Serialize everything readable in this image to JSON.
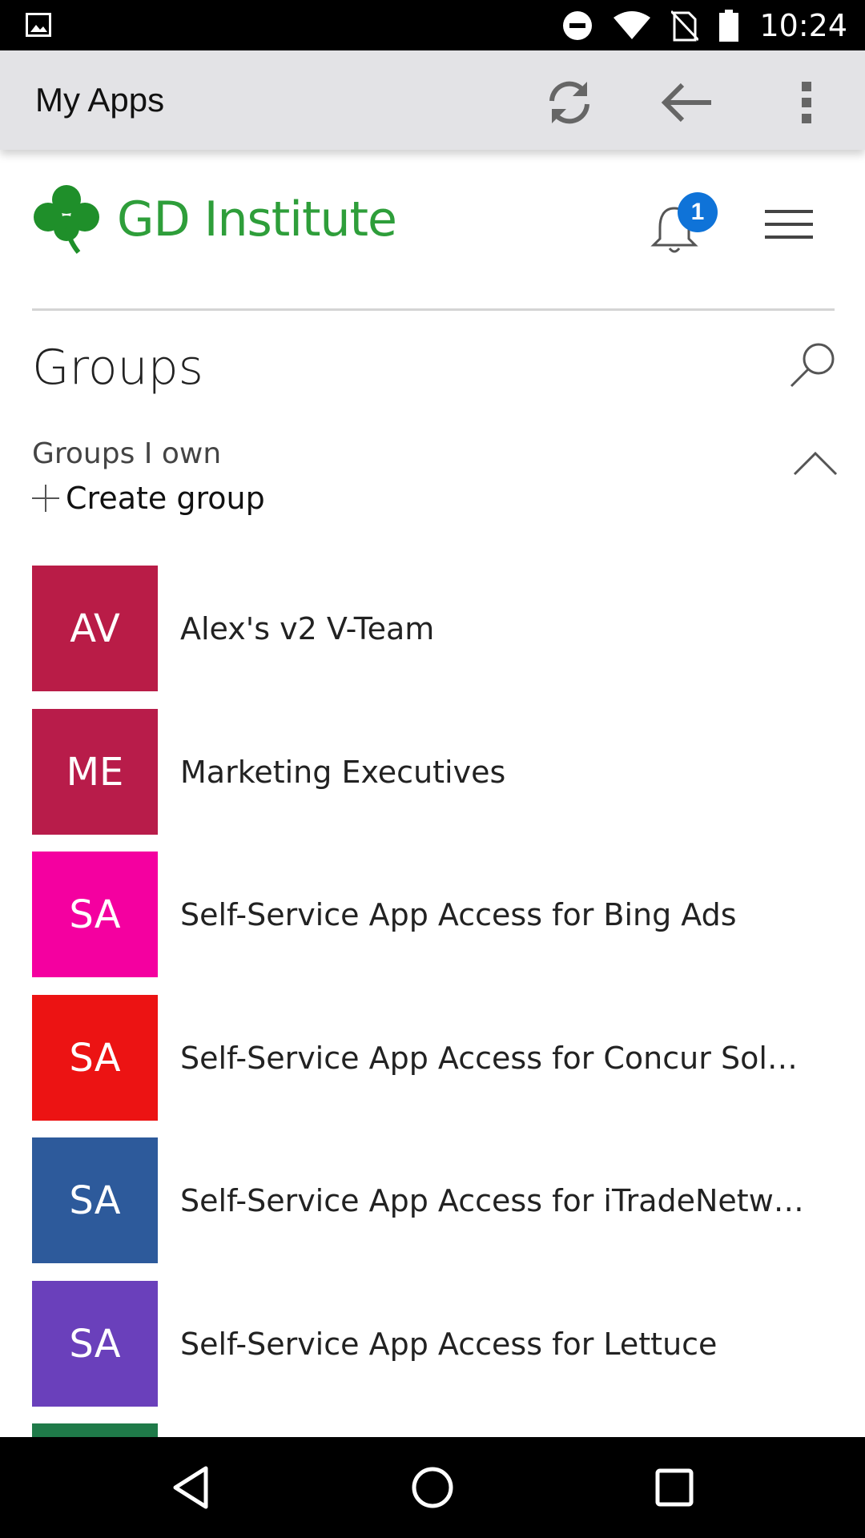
{
  "status_bar": {
    "time": "10:24"
  },
  "app_bar": {
    "title": "My Apps"
  },
  "header": {
    "brand_name": "GD Institute",
    "notification_count": "1"
  },
  "groups": {
    "title": "Groups",
    "section_label": "Groups I own",
    "create_label": "Create group",
    "items": [
      {
        "initials": "AV",
        "name": "Alex's v2 V-Team",
        "color": "#b91c47"
      },
      {
        "initials": "ME",
        "name": "Marketing Executives",
        "color": "#b81c4a"
      },
      {
        "initials": "SA",
        "name": "Self-Service App Access for Bing Ads",
        "color": "#f400a0"
      },
      {
        "initials": "SA",
        "name": "Self-Service App Access for Concur Soluti...",
        "color": "#ec1313"
      },
      {
        "initials": "SA",
        "name": "Self-Service App Access for iTradeNetwor...",
        "color": "#2d5a9b"
      },
      {
        "initials": "SA",
        "name": "Self-Service App Access for Lettuce",
        "color": "#6a40bb"
      },
      {
        "initials": "",
        "name": "",
        "color": "#1f7a49"
      }
    ]
  }
}
